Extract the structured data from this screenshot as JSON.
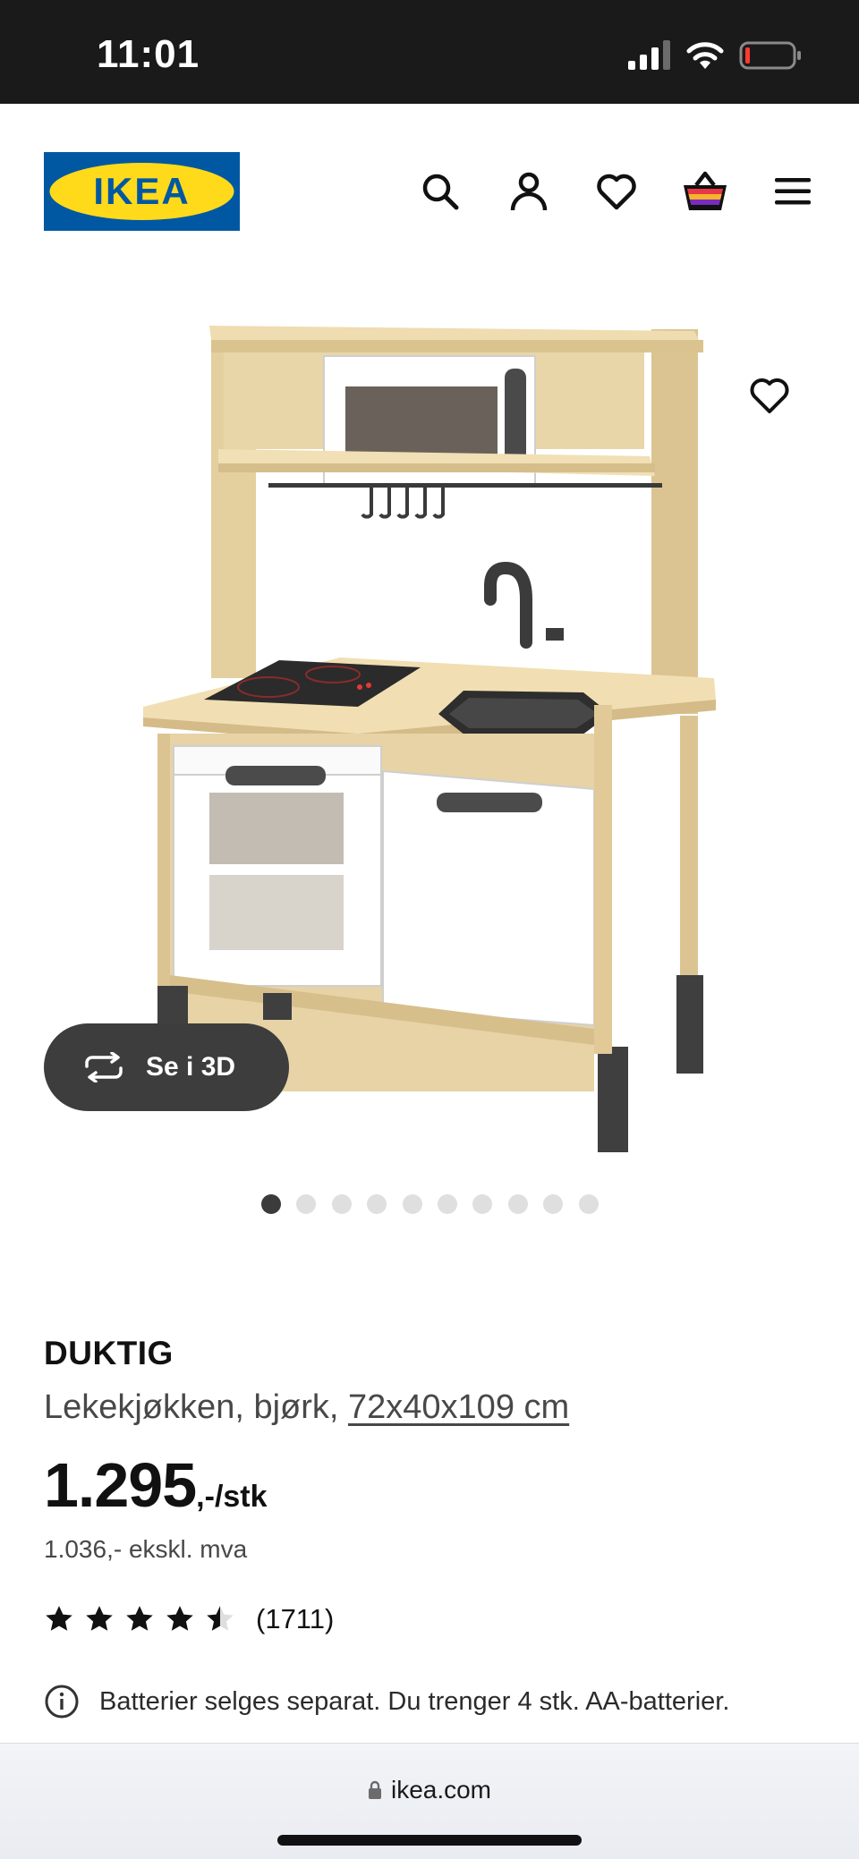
{
  "status_bar": {
    "time": "11:01"
  },
  "header": {
    "logo_text": "IKEA",
    "brand_colors": {
      "blue": "#0058a3",
      "yellow": "#ffda1a"
    },
    "icons": [
      "search-icon",
      "account-icon",
      "favorites-icon",
      "shopping-bag-icon",
      "menu-icon"
    ]
  },
  "gallery": {
    "button_3d_label": "Se i 3D",
    "image_count": 10,
    "active_index": 0
  },
  "product": {
    "name": "DUKTIG",
    "description": "Lekekjøkken, bjørk,",
    "dimensions": "72x40x109 cm",
    "price_main": "1.295",
    "price_suffix": ",-/stk",
    "price_ex_vat": "1.036,- ekskl. mva",
    "rating": 4.5,
    "rating_count": "(1711)",
    "info_note": "Batterier selges separat. Du trenger 4 stk. AA-batterier."
  },
  "browser": {
    "url": "ikea.com"
  }
}
